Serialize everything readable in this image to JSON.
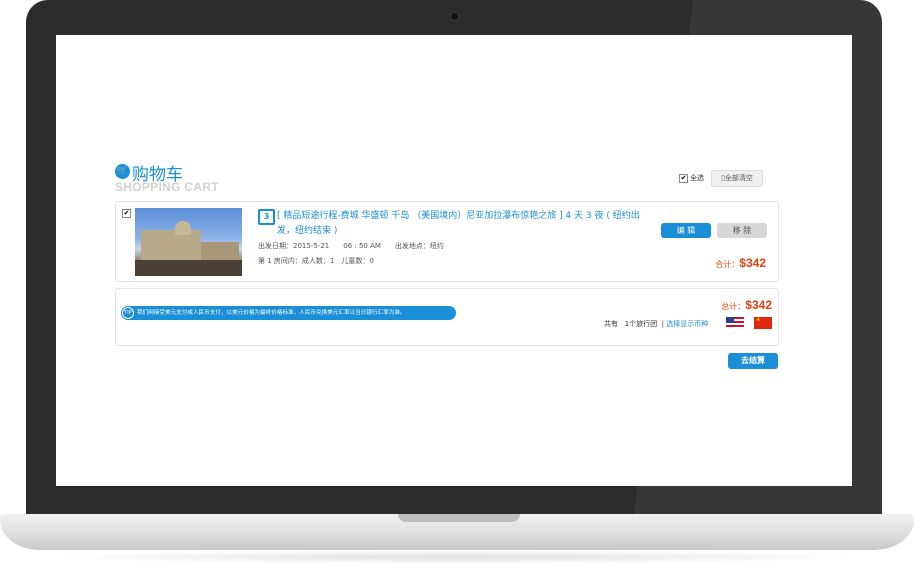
{
  "header": {
    "title": "购物车",
    "subtitle": "SHOPPING CART",
    "select_all_label": "全选",
    "clear_all_label": "全部清空"
  },
  "item": {
    "checked": true,
    "title": "[ 精品短途行程-费城 华盛顿 千岛 （美国境内）尼亚加拉瀑布惊艳之旅 ] 4 天 3 夜 ( 纽约出发，纽约结束 )",
    "departure_date_label": "出发日期：",
    "departure_date": "2015-5-21",
    "departure_time": "06 : 50 AM",
    "departure_place_label": "出发地点：",
    "departure_place": "纽约",
    "room_info": "第 1 房间内：成人数：1　儿童数：0",
    "edit_label": "编 辑",
    "remove_label": "移 除",
    "subtotal_label": "合计：",
    "subtotal_amount": "$342"
  },
  "summary": {
    "tip_badge": "TIP",
    "tip_text": "我们网接受美元支付或人民币支付，以美元价格为最终价格标准，人民币兑换美元汇率以当日银行汇率为准。",
    "total_label": "总计：",
    "total_amount": "$342",
    "group_count_prefix": "共有",
    "group_count": "1个旅行团",
    "currency_link": "选择显示币种",
    "currencies": [
      "flag-us-icon",
      "flag-cn-icon"
    ]
  },
  "checkout_label": "去结算",
  "colors": {
    "accent": "#1a8fd8",
    "price": "#e8400f",
    "bezel": "#2b2b2b"
  }
}
